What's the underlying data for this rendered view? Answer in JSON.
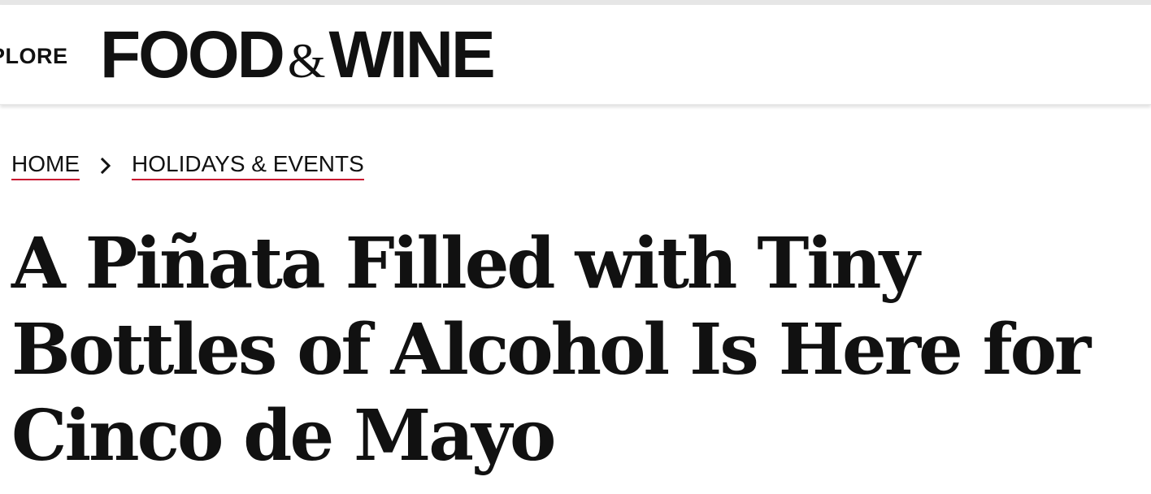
{
  "header": {
    "explore_label": "PLORE",
    "logo": {
      "food": "FOOD",
      "amp": "&",
      "wine": "WINE"
    }
  },
  "breadcrumb": {
    "items": [
      "HOME",
      "HOLIDAYS & EVENTS"
    ],
    "separator_icon": "chevron-right-icon",
    "underline_color": "#c8102e"
  },
  "article": {
    "headline": "A Piñata Filled with Tiny Bottles of Alcohol Is Here for Cinco de Mayo"
  },
  "colors": {
    "text": "#111111",
    "background": "#ffffff",
    "accent": "#c8102e"
  }
}
